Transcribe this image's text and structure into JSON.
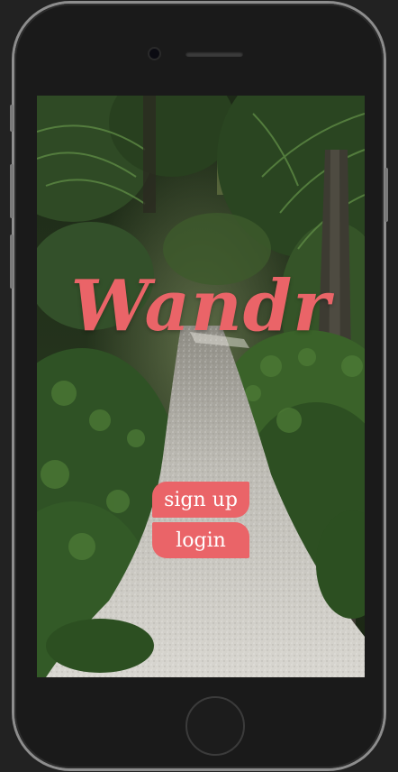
{
  "app": {
    "title": "Wandr"
  },
  "actions": {
    "signup_label": "sign up",
    "login_label": "login"
  },
  "colors": {
    "accent": "#ea6468",
    "device_frame": "#1a1a1a",
    "background": "#222222"
  },
  "background_image": {
    "icon": "jungle-path-photo"
  }
}
